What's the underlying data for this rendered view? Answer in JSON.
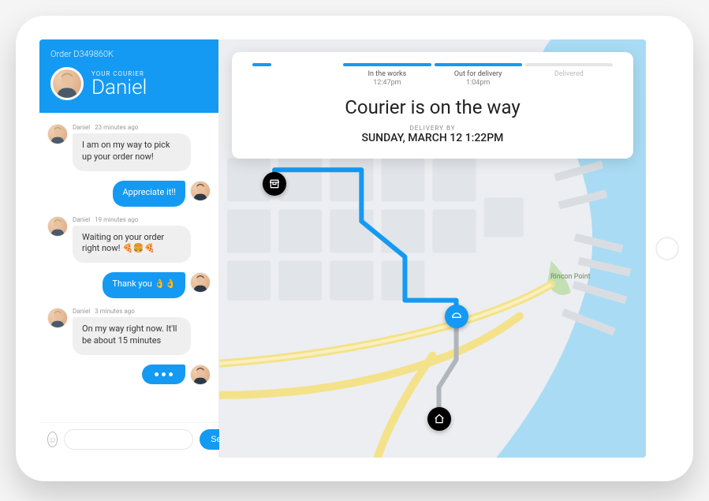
{
  "colors": {
    "accent": "#149af3"
  },
  "order": {
    "label": "Order D349860K"
  },
  "courier": {
    "label": "YOUR COURIER",
    "name": "Daniel"
  },
  "messages": [
    {
      "from": "courier",
      "name": "Daniel",
      "time": "23 minutes ago",
      "text": "I am on my way to pick up your order now!"
    },
    {
      "from": "me",
      "text": "Appreciate it!!"
    },
    {
      "from": "courier",
      "name": "Daniel",
      "time": "19 minutes ago",
      "text": "Waiting on your order right now! 🍕🍔🍕"
    },
    {
      "from": "me",
      "text": "Thank you 👌👌"
    },
    {
      "from": "courier",
      "name": "Daniel",
      "time": "3 minutes ago",
      "text": "On my way right now. It'll be about 15 minutes"
    },
    {
      "from": "me",
      "typing": true
    }
  ],
  "compose": {
    "placeholder": "",
    "send_label": "Send"
  },
  "status": {
    "segments": [
      {
        "label": "",
        "time": "",
        "state": "dot"
      },
      {
        "label": "In the works",
        "time": "12:47pm",
        "state": "active"
      },
      {
        "label": "Out for delivery",
        "time": "1:04pm",
        "state": "active"
      },
      {
        "label": "Delivered",
        "time": "",
        "state": "muted"
      }
    ],
    "title": "Courier is on the way",
    "delivery_by_label": "DELIVERY BY",
    "delivery_by": "SUNDAY, MARCH 12 1:22PM"
  },
  "map": {
    "poi": [
      {
        "name": "Rincon Point"
      }
    ],
    "pins": [
      {
        "icon": "store-icon",
        "style": "black"
      },
      {
        "icon": "courier-icon",
        "style": "blue"
      },
      {
        "icon": "home-icon",
        "style": "black"
      }
    ]
  }
}
